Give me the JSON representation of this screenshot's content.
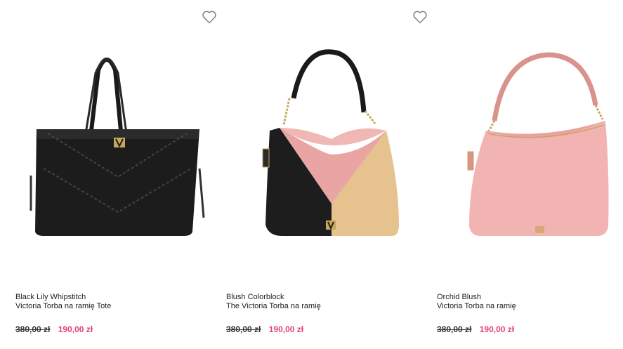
{
  "colors": {
    "sale": "#e5407a",
    "text": "#222222",
    "heart": "#888888"
  },
  "products": [
    {
      "name": "Black Lily Whipstitch",
      "subtitle": "Victoria Torba na ramię Tote",
      "old_price": "380,00 zł",
      "new_price": "190,00 zł",
      "wishlist_icon": "heart-outline-icon"
    },
    {
      "name": "Blush Colorblock",
      "subtitle": "The Victoria Torba na ramię",
      "old_price": "380,00 zł",
      "new_price": "190,00 zł",
      "wishlist_icon": "heart-outline-icon"
    },
    {
      "name": "Orchid Blush",
      "subtitle": "Victoria Torba na ramię",
      "old_price": "380,00 zł",
      "new_price": "190,00 zł",
      "wishlist_icon": "heart-outline-icon"
    }
  ]
}
